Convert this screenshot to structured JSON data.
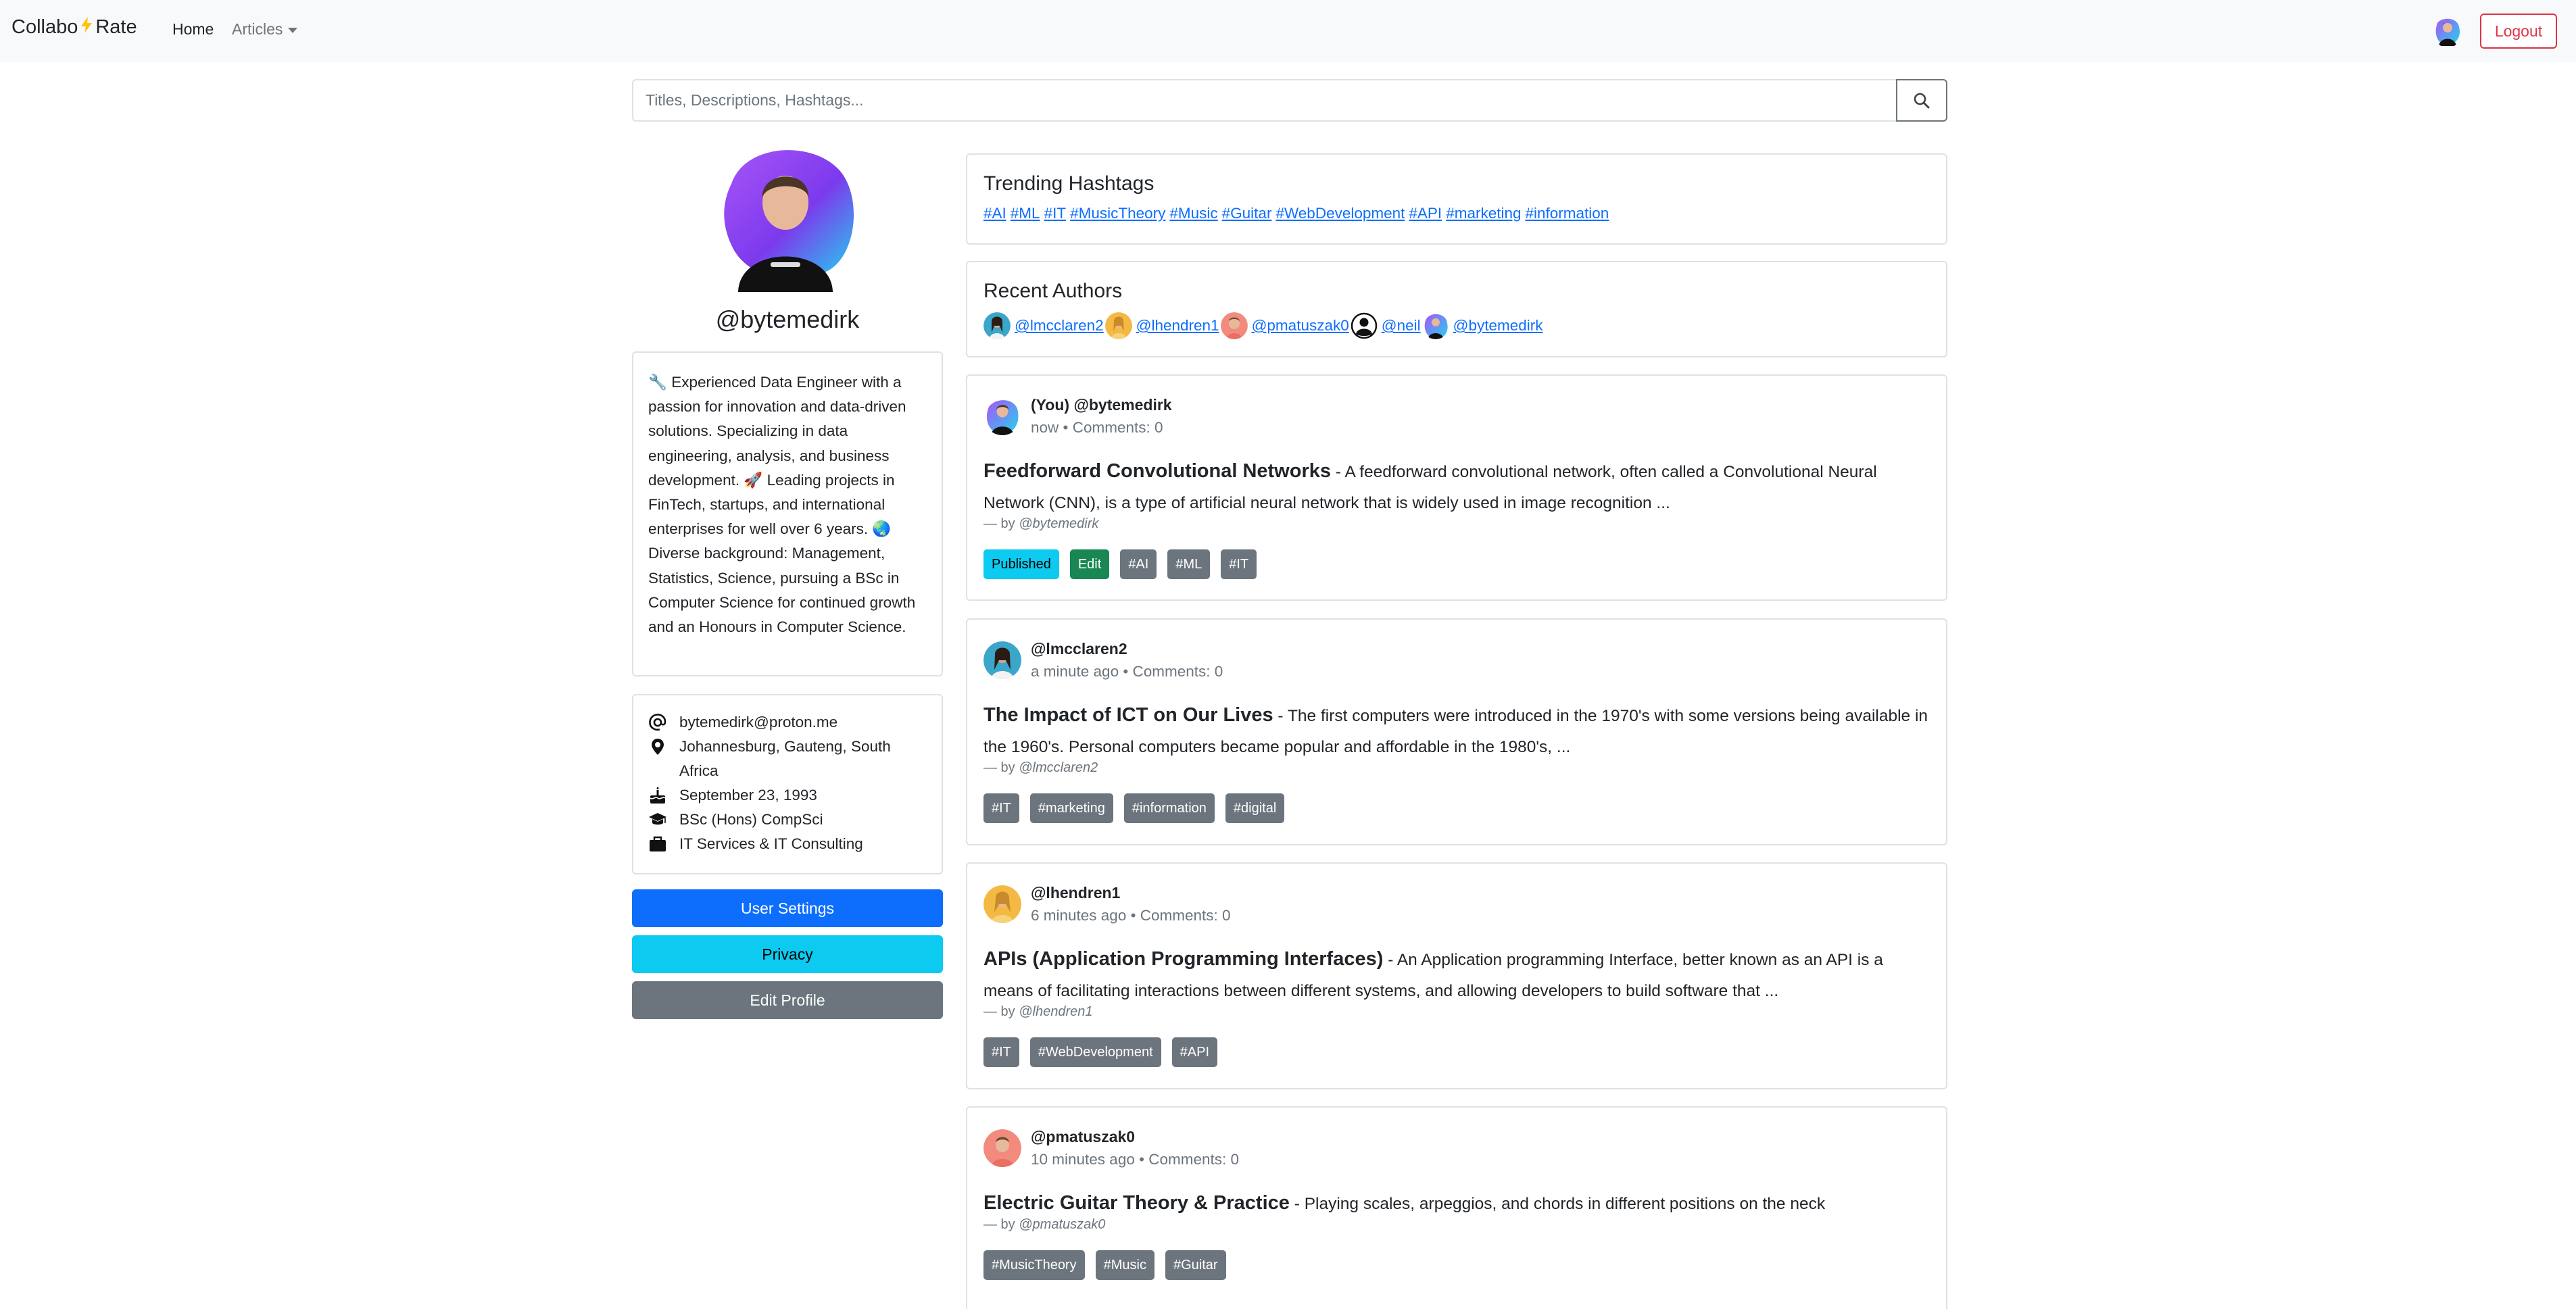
{
  "nav": {
    "brand_left": "Collabo",
    "brand_icon": "lightning-icon",
    "brand_right": "Rate",
    "home": "Home",
    "articles": "Articles",
    "logout": "Logout"
  },
  "search": {
    "placeholder": "Titles, Descriptions, Hashtags...",
    "button_icon": "search-icon"
  },
  "profile": {
    "handle": "@bytemedirk",
    "bio": "🔧 Experienced Data Engineer with a passion for innovation and data-driven solutions. Specializing in data engineering, analysis, and business development. 🚀 Leading projects in FinTech, startups, and international enterprises for well over 6 years. 🌏 Diverse background: Management, Statistics, Science, pursuing a BSc in Computer Science for continued growth and an Honours in Computer Science.",
    "info": {
      "email": "bytemedirk@proton.me",
      "location": "Johannesburg, Gauteng, South Africa",
      "birthday": "September 23, 1993",
      "education": "BSc (Hons) CompSci",
      "work": "IT Services & IT Consulting"
    },
    "buttons": {
      "settings": "User Settings",
      "privacy": "Privacy",
      "edit": "Edit Profile"
    }
  },
  "trending": {
    "title": "Trending Hashtags",
    "tags": [
      "#AI",
      "#ML",
      "#IT",
      "#MusicTheory",
      "#Music",
      "#Guitar",
      "#WebDevelopment",
      "#API",
      "#marketing",
      "#information"
    ]
  },
  "recent_authors": {
    "title": "Recent Authors",
    "authors": [
      "@lmcclaren2",
      "@lhendren1",
      "@pmatuszak0",
      "@neil",
      "@bytemedirk"
    ]
  },
  "posts": [
    {
      "author": "(You) @bytemedirk",
      "time": "now",
      "comments": "Comments: 0",
      "title": "Feedforward Convolutional Networks",
      "desc": "A feedforward convolutional network, often called a Convolutional Neural Network (CNN), is a type of artificial neural network that is widely used in image recognition ...",
      "by": "@bytemedirk",
      "status": "Published",
      "edit": "Edit",
      "tags": [
        "#AI",
        "#ML",
        "#IT"
      ]
    },
    {
      "author": "@lmcclaren2",
      "time": "a minute ago",
      "comments": "Comments: 0",
      "title": "The Impact of ICT on Our Lives",
      "desc": "The first computers were introduced in the 1970's with some versions being available in the 1960's. Personal computers became popular and affordable in the 1980's, ...",
      "by": "@lmcclaren2",
      "tags": [
        "#IT",
        "#marketing",
        "#information",
        "#digital"
      ]
    },
    {
      "author": "@lhendren1",
      "time": "6 minutes ago",
      "comments": "Comments: 0",
      "title": "APIs (Application Programming Interfaces)",
      "desc": "An Application programming Interface, better known as an API is a means of facilitating interactions between different systems, and allowing developers to build software that ...",
      "by": "@lhendren1",
      "tags": [
        "#IT",
        "#WebDevelopment",
        "#API"
      ]
    },
    {
      "author": "@pmatuszak0",
      "time": "10 minutes ago",
      "comments": "Comments: 0",
      "title": "Electric Guitar Theory & Practice",
      "desc": "Playing scales, arpeggios, and chords in different positions on the neck",
      "by": "@pmatuszak0",
      "tags": [
        "#MusicTheory",
        "#Music",
        "#Guitar"
      ]
    }
  ],
  "separators": {
    "bullet": "•",
    "title_dash": "-",
    "by_prefix": "— by"
  },
  "colors": {
    "primary": "#0d6efd",
    "info": "#0dcaf0",
    "secondary": "#6c757d",
    "success": "#198754",
    "danger": "#dc3545"
  }
}
